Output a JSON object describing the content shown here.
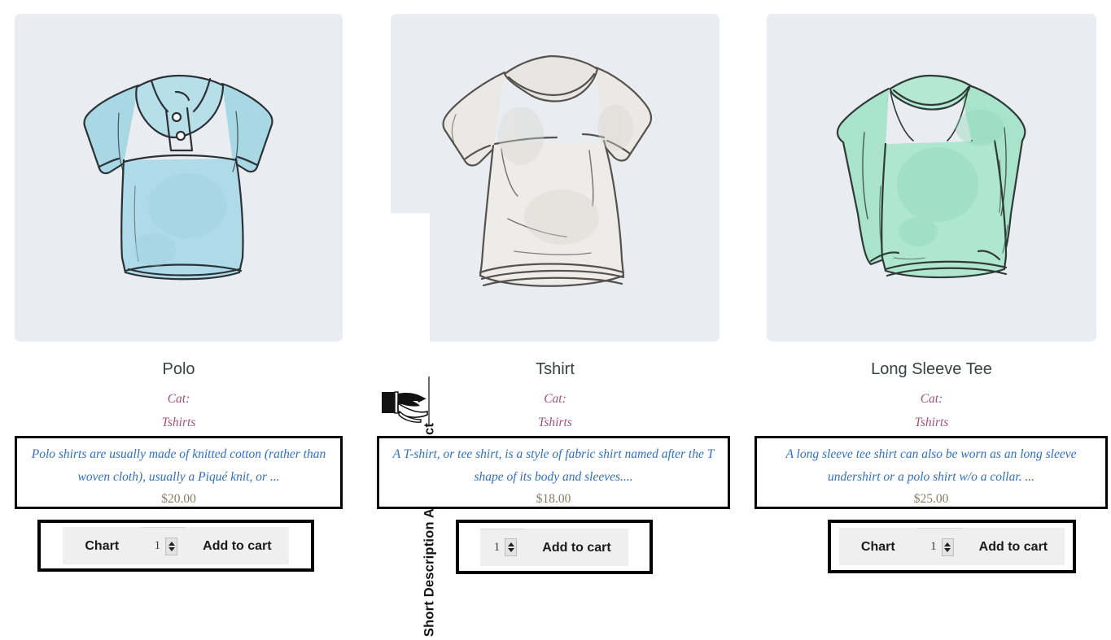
{
  "annotation": {
    "label": "Short Description About Product",
    "pointer_icon": "pointing-hand-icon"
  },
  "colors": {
    "panel_background": "#e9edf1",
    "description_text": "#2f6fc4",
    "category_text": "#a3527c",
    "price_text": "#8c7b63",
    "title_text": "#3c4043",
    "button_face": "#efefef",
    "annotation_border": "#000000"
  },
  "products": [
    {
      "title": "Polo",
      "category_label": "Cat:",
      "category_value": "Tshirts",
      "description": "Polo shirts are usually made of knitted cotton (rather than woven cloth), usually a Piqué knit, or ...",
      "price": "$20.00",
      "image_alt": "polo-shirt-illustration",
      "image_color": "#9fd3e0",
      "chart_label": "Chart",
      "has_chart_button": true,
      "quantity": "1",
      "add_to_cart_label": "Add to cart"
    },
    {
      "title": "Tshirt",
      "category_label": "Cat:",
      "category_value": "Tshirts",
      "description": "A T-shirt, or tee shirt, is a style of fabric shirt named after the T shape of its body and sleeves....",
      "price": "$18.00",
      "image_alt": "tshirt-illustration",
      "image_color": "#eceae6",
      "chart_label": "Chart",
      "has_chart_button": false,
      "quantity": "1",
      "add_to_cart_label": "Add to cart"
    },
    {
      "title": "Long Sleeve Tee",
      "category_label": "Cat:",
      "category_value": "Tshirts",
      "description": "A long sleeve tee shirt can also be worn as an long sleeve undershirt or a polo shirt w/o a collar. ...",
      "price": "$25.00",
      "image_alt": "long-sleeve-tee-illustration",
      "image_color": "#a5e0c6",
      "chart_label": "Chart",
      "has_chart_button": true,
      "quantity": "1",
      "add_to_cart_label": "Add to cart"
    }
  ]
}
